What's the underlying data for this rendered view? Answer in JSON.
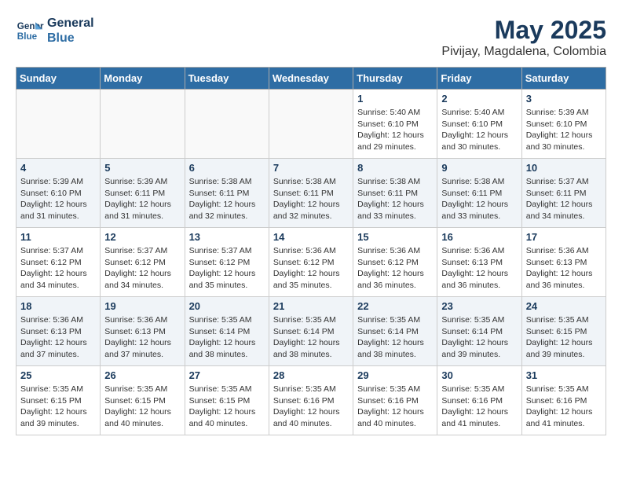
{
  "header": {
    "logo_line1": "General",
    "logo_line2": "Blue",
    "month_year": "May 2025",
    "location": "Pivijay, Magdalena, Colombia"
  },
  "weekdays": [
    "Sunday",
    "Monday",
    "Tuesday",
    "Wednesday",
    "Thursday",
    "Friday",
    "Saturday"
  ],
  "weeks": [
    [
      {
        "day": "",
        "info": ""
      },
      {
        "day": "",
        "info": ""
      },
      {
        "day": "",
        "info": ""
      },
      {
        "day": "",
        "info": ""
      },
      {
        "day": "1",
        "info": "Sunrise: 5:40 AM\nSunset: 6:10 PM\nDaylight: 12 hours\nand 29 minutes."
      },
      {
        "day": "2",
        "info": "Sunrise: 5:40 AM\nSunset: 6:10 PM\nDaylight: 12 hours\nand 30 minutes."
      },
      {
        "day": "3",
        "info": "Sunrise: 5:39 AM\nSunset: 6:10 PM\nDaylight: 12 hours\nand 30 minutes."
      }
    ],
    [
      {
        "day": "4",
        "info": "Sunrise: 5:39 AM\nSunset: 6:10 PM\nDaylight: 12 hours\nand 31 minutes."
      },
      {
        "day": "5",
        "info": "Sunrise: 5:39 AM\nSunset: 6:11 PM\nDaylight: 12 hours\nand 31 minutes."
      },
      {
        "day": "6",
        "info": "Sunrise: 5:38 AM\nSunset: 6:11 PM\nDaylight: 12 hours\nand 32 minutes."
      },
      {
        "day": "7",
        "info": "Sunrise: 5:38 AM\nSunset: 6:11 PM\nDaylight: 12 hours\nand 32 minutes."
      },
      {
        "day": "8",
        "info": "Sunrise: 5:38 AM\nSunset: 6:11 PM\nDaylight: 12 hours\nand 33 minutes."
      },
      {
        "day": "9",
        "info": "Sunrise: 5:38 AM\nSunset: 6:11 PM\nDaylight: 12 hours\nand 33 minutes."
      },
      {
        "day": "10",
        "info": "Sunrise: 5:37 AM\nSunset: 6:11 PM\nDaylight: 12 hours\nand 34 minutes."
      }
    ],
    [
      {
        "day": "11",
        "info": "Sunrise: 5:37 AM\nSunset: 6:12 PM\nDaylight: 12 hours\nand 34 minutes."
      },
      {
        "day": "12",
        "info": "Sunrise: 5:37 AM\nSunset: 6:12 PM\nDaylight: 12 hours\nand 34 minutes."
      },
      {
        "day": "13",
        "info": "Sunrise: 5:37 AM\nSunset: 6:12 PM\nDaylight: 12 hours\nand 35 minutes."
      },
      {
        "day": "14",
        "info": "Sunrise: 5:36 AM\nSunset: 6:12 PM\nDaylight: 12 hours\nand 35 minutes."
      },
      {
        "day": "15",
        "info": "Sunrise: 5:36 AM\nSunset: 6:12 PM\nDaylight: 12 hours\nand 36 minutes."
      },
      {
        "day": "16",
        "info": "Sunrise: 5:36 AM\nSunset: 6:13 PM\nDaylight: 12 hours\nand 36 minutes."
      },
      {
        "day": "17",
        "info": "Sunrise: 5:36 AM\nSunset: 6:13 PM\nDaylight: 12 hours\nand 36 minutes."
      }
    ],
    [
      {
        "day": "18",
        "info": "Sunrise: 5:36 AM\nSunset: 6:13 PM\nDaylight: 12 hours\nand 37 minutes."
      },
      {
        "day": "19",
        "info": "Sunrise: 5:36 AM\nSunset: 6:13 PM\nDaylight: 12 hours\nand 37 minutes."
      },
      {
        "day": "20",
        "info": "Sunrise: 5:35 AM\nSunset: 6:14 PM\nDaylight: 12 hours\nand 38 minutes."
      },
      {
        "day": "21",
        "info": "Sunrise: 5:35 AM\nSunset: 6:14 PM\nDaylight: 12 hours\nand 38 minutes."
      },
      {
        "day": "22",
        "info": "Sunrise: 5:35 AM\nSunset: 6:14 PM\nDaylight: 12 hours\nand 38 minutes."
      },
      {
        "day": "23",
        "info": "Sunrise: 5:35 AM\nSunset: 6:14 PM\nDaylight: 12 hours\nand 39 minutes."
      },
      {
        "day": "24",
        "info": "Sunrise: 5:35 AM\nSunset: 6:15 PM\nDaylight: 12 hours\nand 39 minutes."
      }
    ],
    [
      {
        "day": "25",
        "info": "Sunrise: 5:35 AM\nSunset: 6:15 PM\nDaylight: 12 hours\nand 39 minutes."
      },
      {
        "day": "26",
        "info": "Sunrise: 5:35 AM\nSunset: 6:15 PM\nDaylight: 12 hours\nand 40 minutes."
      },
      {
        "day": "27",
        "info": "Sunrise: 5:35 AM\nSunset: 6:15 PM\nDaylight: 12 hours\nand 40 minutes."
      },
      {
        "day": "28",
        "info": "Sunrise: 5:35 AM\nSunset: 6:16 PM\nDaylight: 12 hours\nand 40 minutes."
      },
      {
        "day": "29",
        "info": "Sunrise: 5:35 AM\nSunset: 6:16 PM\nDaylight: 12 hours\nand 40 minutes."
      },
      {
        "day": "30",
        "info": "Sunrise: 5:35 AM\nSunset: 6:16 PM\nDaylight: 12 hours\nand 41 minutes."
      },
      {
        "day": "31",
        "info": "Sunrise: 5:35 AM\nSunset: 6:16 PM\nDaylight: 12 hours\nand 41 minutes."
      }
    ]
  ]
}
